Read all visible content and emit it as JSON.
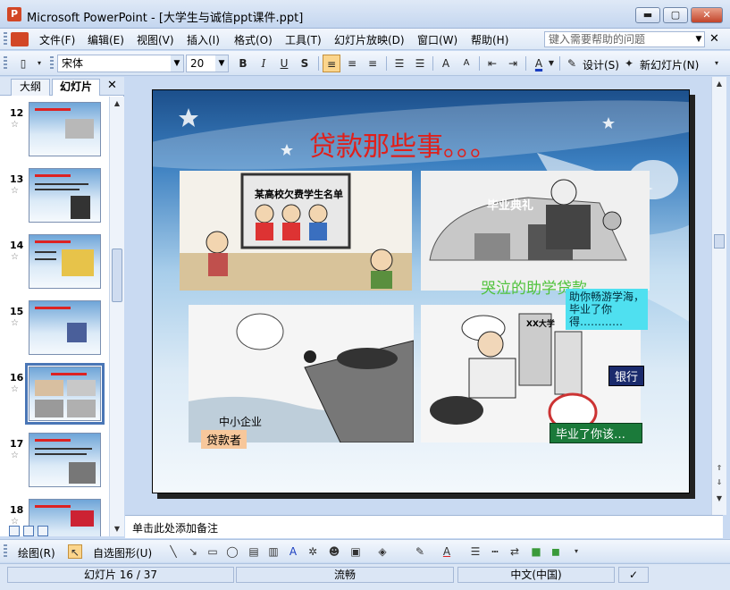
{
  "window": {
    "title": "Microsoft PowerPoint - [大学生与诚信ppt课件.ppt]",
    "app_icon": "P",
    "min_glyph": "▬",
    "max_glyph": "▢",
    "close_glyph": "✕"
  },
  "menu": {
    "items": [
      "文件(F)",
      "编辑(E)",
      "视图(V)",
      "插入(I)",
      "格式(O)",
      "工具(T)",
      "幻灯片放映(D)",
      "窗口(W)",
      "帮助(H)"
    ],
    "help_placeholder": "键入需要帮助的问题",
    "close_glyph": "✕"
  },
  "format_toolbar": {
    "font_name": "宋体",
    "font_size": "20",
    "bold": "B",
    "italic": "I",
    "underline": "U",
    "shadow": "S",
    "design_label": "设计(S)",
    "new_slide_label": "新幻灯片(N)",
    "grow_font": "A",
    "shrink_font": "A",
    "font_color": "A"
  },
  "left_panel": {
    "tabs": [
      "大纲",
      "幻灯片"
    ],
    "close_glyph": "✕",
    "slides": [
      {
        "number": "12"
      },
      {
        "number": "13"
      },
      {
        "number": "14"
      },
      {
        "number": "15"
      },
      {
        "number": "16",
        "selected": true
      },
      {
        "number": "17"
      },
      {
        "number": "18"
      }
    ],
    "star_glyph": "☆"
  },
  "slide": {
    "title": "贷款那些事。。。",
    "panel2_caption": "哭泣的助学贷款",
    "panel3_tag": "贷款者",
    "panel4_callout": "助你畅游学海，毕业了你得…………",
    "panel4_bank": "银行",
    "panel4_bottom": "毕业了你该…",
    "panel1_board": "某高校欠费学生名单",
    "panel2_sign": "毕业典礼",
    "panel3_label": "中小企业",
    "panel4_school": "XX大学",
    "colors": {
      "title": "#e0201b",
      "caption": "#4fc23b",
      "callout_bg": "#4fe0f0",
      "bank_bg": "#1a2a6c",
      "bottom_bg": "#1b7a3a",
      "tag_bg": "#f7c79b"
    }
  },
  "notes": {
    "placeholder": "单击此处添加备注"
  },
  "draw_toolbar": {
    "draw_label": "绘图(R)",
    "autoshapes_label": "自选图形(U)"
  },
  "status": {
    "slide_info": "幻灯片 16 / 37",
    "design": "流畅",
    "language": "中文(中国)"
  }
}
